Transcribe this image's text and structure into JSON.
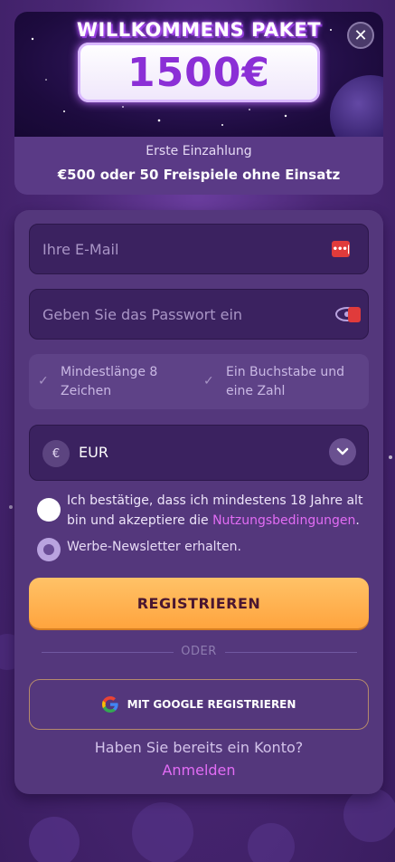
{
  "banner": {
    "title": "WILLKOMMENS PAKET",
    "amount": "1500€",
    "subtitle": "Erste Einzahlung",
    "offer": "€500 oder 50 Freispiele ohne Einsatz"
  },
  "form": {
    "email_placeholder": "Ihre E-Mail",
    "password_placeholder": "Geben Sie das Passwort ein",
    "password_manager_icon_text": "•••|",
    "requirements": [
      {
        "label": "Mindestlänge 8 Zeichen"
      },
      {
        "label": "Ein Buchstabe und eine Zahl"
      }
    ],
    "currency": {
      "symbol": "€",
      "value": "EUR"
    },
    "consent_prefix": "Ich bestätige, dass ich mindestens 18 Jahre alt bin und akzeptiere die ",
    "terms_link": "Nutzungsbedingungen",
    "consent_suffix": ".",
    "newsletter_label": "Werbe-Newsletter erhalten.",
    "register_label": "REGISTRIEREN",
    "divider_label": "ODER",
    "google_label": "MIT GOOGLE REGISTRIEREN",
    "login_question": "Haben Sie bereits ein Konto?",
    "login_link": "Anmelden"
  },
  "icons": {
    "close": "close-icon",
    "check": "check-icon",
    "eye": "eye-icon",
    "chevron": "chevron-down-icon",
    "google": "google-icon",
    "euro": "euro-icon"
  },
  "colors": {
    "accent_link": "#e26cf5",
    "register_button": "#ffb04f",
    "card_background": "#54377c",
    "page_background": "#4a2775"
  }
}
